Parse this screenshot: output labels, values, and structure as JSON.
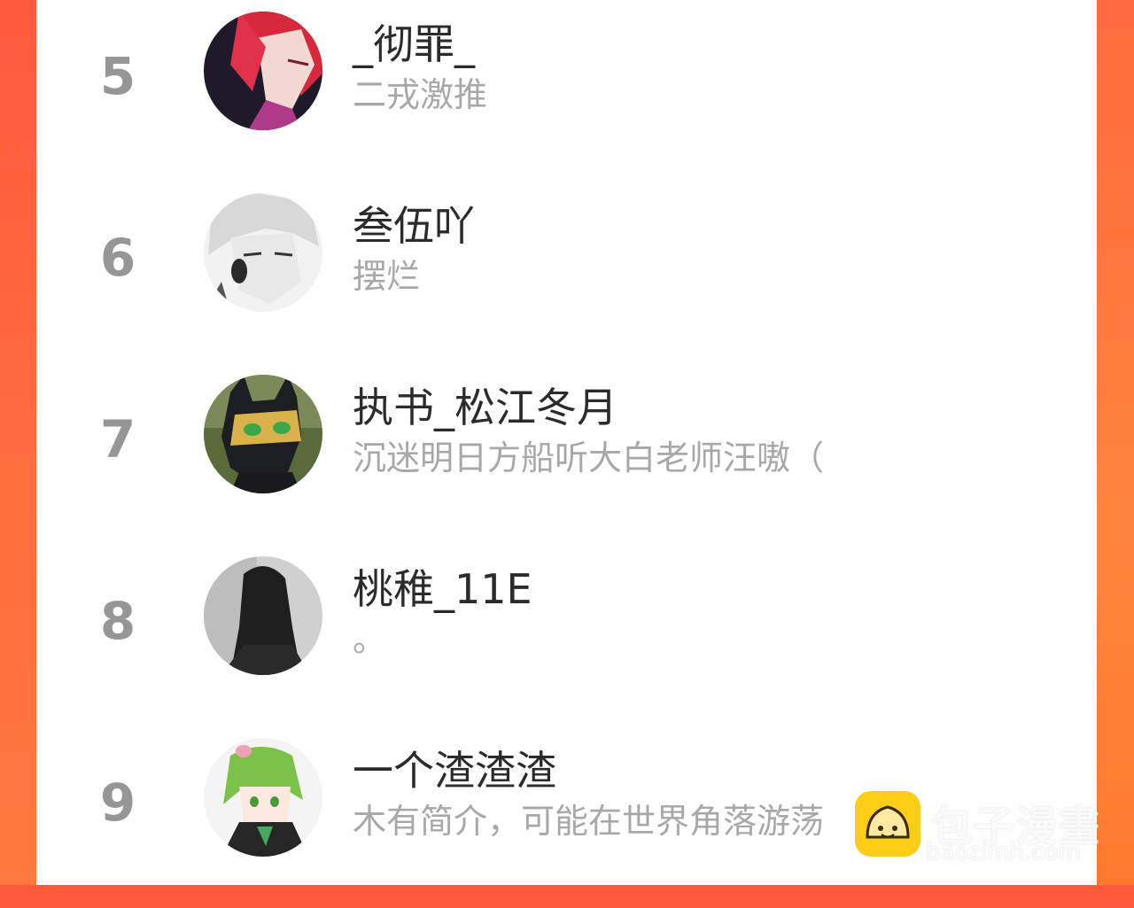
{
  "users": [
    {
      "rank": "5",
      "name": "_彻罪_",
      "bio": "二戎激推",
      "avatar": "red-hair-anime-avatar"
    },
    {
      "rank": "6",
      "name": "叁伍吖",
      "bio": "摆烂",
      "avatar": "white-hair-anime-avatar"
    },
    {
      "rank": "7",
      "name": "执书_松江冬月",
      "bio": "沉迷明日方船听大白老师汪嗷（",
      "avatar": "cat-mask-hero-avatar"
    },
    {
      "rank": "8",
      "name": "桃稚_11E",
      "bio": "。",
      "avatar": "dark-hair-girl-avatar"
    },
    {
      "rank": "9",
      "name": "一个渣渣渣",
      "bio": "木有简介，可能在世界角落游荡",
      "avatar": "green-hair-anime-avatar"
    }
  ],
  "watermark": {
    "title": "包子漫畫",
    "url": "baozimh.com"
  },
  "colors": {
    "background": "#ff5a3c",
    "panel": "#ffffff",
    "rank": "#969696",
    "name": "#2b2b2b",
    "bio": "#a8a8a8"
  }
}
